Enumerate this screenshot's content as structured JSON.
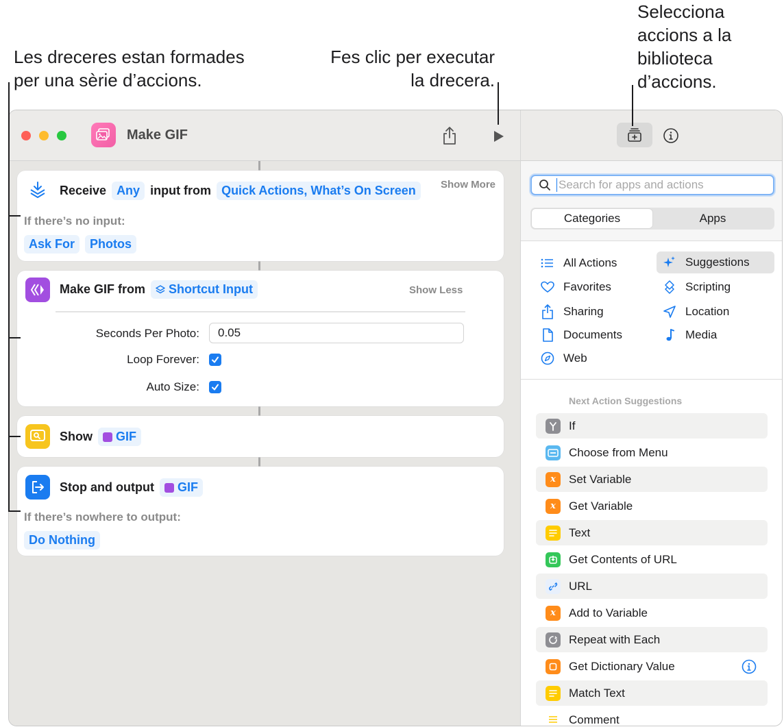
{
  "callouts": {
    "left": [
      "Les dreceres estan formades",
      "per una sèrie d’accions."
    ],
    "middle": [
      "Fes clic per executar",
      "la drecera."
    ],
    "right": [
      "Selecciona",
      "accions a la",
      "biblioteca",
      "d’accions."
    ]
  },
  "window": {
    "title": "Make GIF"
  },
  "actions": {
    "receive": {
      "verb": "Receive",
      "type_token": "Any",
      "middle": "input from",
      "source_token": "Quick Actions, What’s On Screen",
      "toggle": "Show More",
      "fallback_label": "If there’s no input:",
      "fallback_tokens": [
        "Ask For",
        "Photos"
      ]
    },
    "make_gif": {
      "verb": "Make GIF from",
      "input_token": "Shortcut Input",
      "toggle": "Show Less",
      "params": {
        "seconds_label": "Seconds Per Photo:",
        "seconds_value": "0.05",
        "loop_label": "Loop Forever:",
        "loop_checked": true,
        "autosize_label": "Auto Size:",
        "autosize_checked": true
      }
    },
    "show": {
      "verb": "Show",
      "token": "GIF"
    },
    "stop": {
      "verb": "Stop and output",
      "token": "GIF",
      "fallback_label": "If there’s nowhere to output:",
      "fallback_token": "Do Nothing"
    }
  },
  "sidebar": {
    "search_placeholder": "Search for apps and actions",
    "tabs": [
      "Categories",
      "Apps"
    ],
    "active_tab": "Categories",
    "categories_left": [
      "All Actions",
      "Favorites",
      "Sharing",
      "Documents",
      "Web"
    ],
    "categories_right": [
      "Suggestions",
      "Scripting",
      "Location",
      "Media"
    ],
    "selected_category": "Suggestions",
    "suggestions_title": "Next Action Suggestions",
    "suggestions": [
      {
        "label": "If",
        "color": "#8e8e93",
        "icon": "branch-icon"
      },
      {
        "label": "Choose from Menu",
        "color": "#5ab8f0",
        "icon": "menu-icon"
      },
      {
        "label": "Set Variable",
        "color": "#ff8c1a",
        "icon": "variable-icon"
      },
      {
        "label": "Get Variable",
        "color": "#ff8c1a",
        "icon": "variable-icon"
      },
      {
        "label": "Text",
        "color": "#ffcc00",
        "icon": "text-icon"
      },
      {
        "label": "Get Contents of URL",
        "color": "#34c759",
        "icon": "download-icon"
      },
      {
        "label": "URL",
        "color": "#e8f0fc",
        "icon": "link-icon"
      },
      {
        "label": "Add to Variable",
        "color": "#ff8c1a",
        "icon": "variable-icon"
      },
      {
        "label": "Repeat with Each",
        "color": "#8e8e93",
        "icon": "repeat-icon"
      },
      {
        "label": "Get Dictionary Value",
        "color": "#ff8c1a",
        "icon": "dictionary-icon"
      },
      {
        "label": "Match Text",
        "color": "#ffcc00",
        "icon": "text-icon"
      },
      {
        "label": "Comment",
        "color": "#ffffff",
        "icon": "comment-icon"
      }
    ]
  },
  "colors": {
    "accent": "#1a7cf0",
    "purple": "#a24ee0",
    "yellow": "#f7c51e"
  }
}
